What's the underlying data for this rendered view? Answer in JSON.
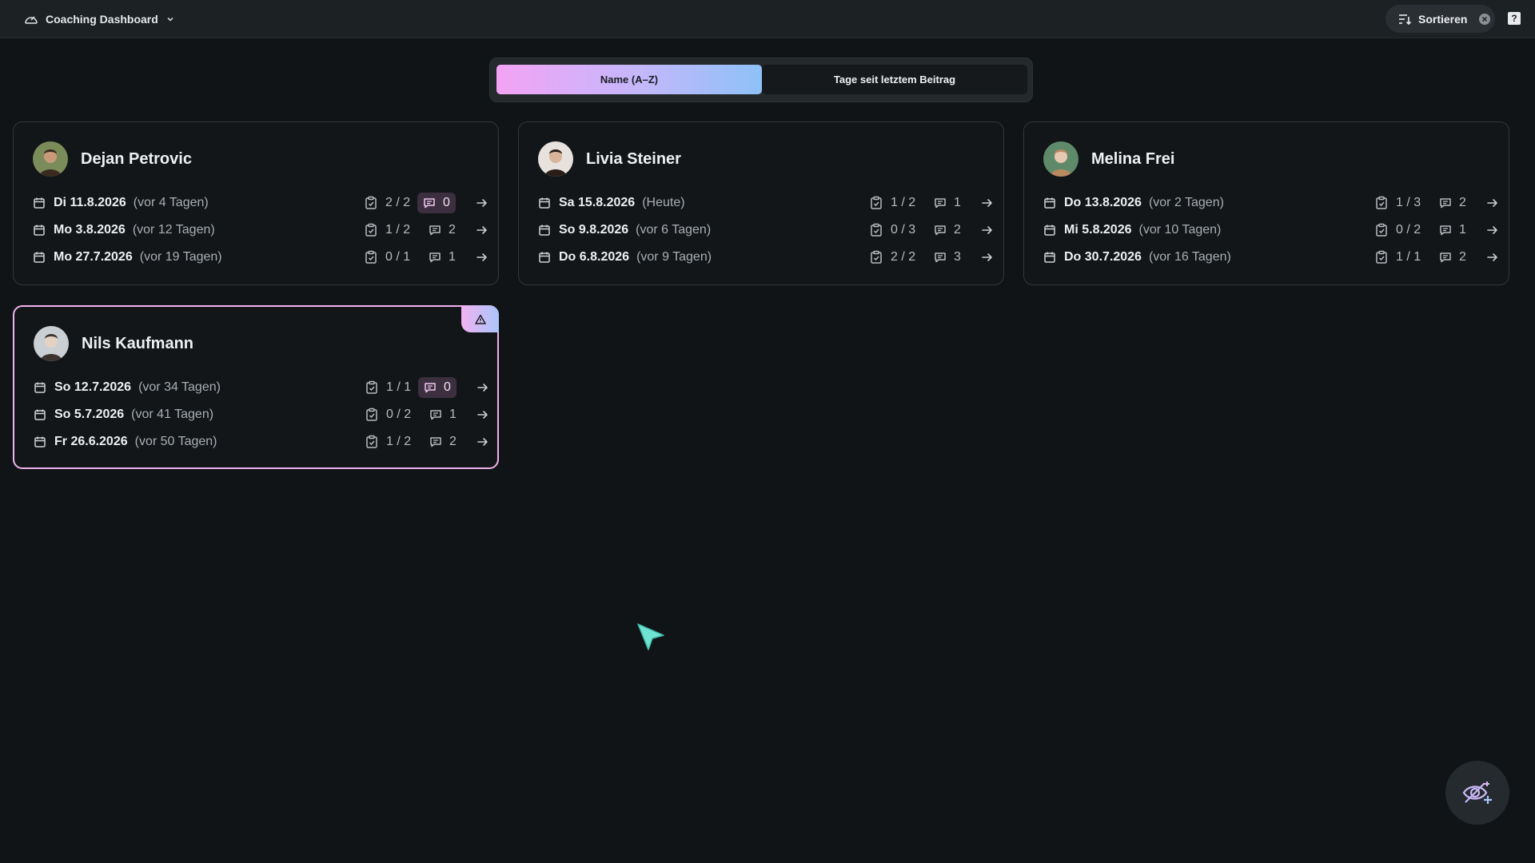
{
  "topbar": {
    "app_title": "Coaching Dashboard",
    "sort_label": "Sortieren"
  },
  "sort_options": {
    "active": "Name (A–Z)",
    "inactive": "Tage seit letztem Beitrag"
  },
  "cards": [
    {
      "name": "Dejan Petrovic",
      "flagged": false,
      "entries": [
        {
          "date": "Di 11.8.2026",
          "relative": "(vor 4 Tagen)",
          "tasks": "2 / 2",
          "comments": "0",
          "comments_alert": true
        },
        {
          "date": "Mo 3.8.2026",
          "relative": "(vor 12 Tagen)",
          "tasks": "1 / 2",
          "comments": "2",
          "comments_alert": false
        },
        {
          "date": "Mo 27.7.2026",
          "relative": "(vor 19 Tagen)",
          "tasks": "0 / 1",
          "comments": "1",
          "comments_alert": false
        }
      ]
    },
    {
      "name": "Livia Steiner",
      "flagged": false,
      "entries": [
        {
          "date": "Sa 15.8.2026",
          "relative": "(Heute)",
          "tasks": "1 / 2",
          "comments": "1",
          "comments_alert": false
        },
        {
          "date": "So 9.8.2026",
          "relative": "(vor 6 Tagen)",
          "tasks": "0 / 3",
          "comments": "2",
          "comments_alert": false
        },
        {
          "date": "Do 6.8.2026",
          "relative": "(vor 9 Tagen)",
          "tasks": "2 / 2",
          "comments": "3",
          "comments_alert": false
        }
      ]
    },
    {
      "name": "Melina Frei",
      "flagged": false,
      "entries": [
        {
          "date": "Do 13.8.2026",
          "relative": "(vor 2 Tagen)",
          "tasks": "1 / 3",
          "comments": "2",
          "comments_alert": false
        },
        {
          "date": "Mi 5.8.2026",
          "relative": "(vor 10 Tagen)",
          "tasks": "0 / 2",
          "comments": "1",
          "comments_alert": false
        },
        {
          "date": "Do 30.7.2026",
          "relative": "(vor 16 Tagen)",
          "tasks": "1 / 1",
          "comments": "2",
          "comments_alert": false
        }
      ]
    },
    {
      "name": "Nils Kaufmann",
      "flagged": true,
      "entries": [
        {
          "date": "So 12.7.2026",
          "relative": "(vor 34 Tagen)",
          "tasks": "1 / 1",
          "comments": "0",
          "comments_alert": true
        },
        {
          "date": "So 5.7.2026",
          "relative": "(vor 41 Tagen)",
          "tasks": "0 / 2",
          "comments": "1",
          "comments_alert": false
        },
        {
          "date": "Fr 26.6.2026",
          "relative": "(vor 50 Tagen)",
          "tasks": "1 / 2",
          "comments": "2",
          "comments_alert": false
        }
      ]
    }
  ],
  "colors": {
    "background": "#111416",
    "topbar": "#1c2124",
    "accent_pink": "#f3a3f4",
    "accent_blue": "#8ec1f8",
    "alert_chip": "#3c2f40"
  },
  "icons": {
    "app": "dashboard-gauge-icon",
    "sort": "sort-lines-icon",
    "clear": "close-circle-icon",
    "help": "help-icon",
    "date": "calendar-icon",
    "tasks": "clipboard-check-icon",
    "comments": "comment-icon",
    "open": "arrow-right-icon",
    "flag": "warning-triangle-icon",
    "fab": "eye-sparkle-icon"
  }
}
